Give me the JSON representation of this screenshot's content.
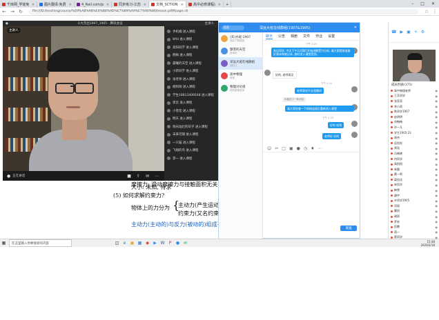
{
  "browser": {
    "tabs": [
      {
        "label": "千库网_学徒免费设计平台",
        "color": "#d93025",
        "active": false
      },
      {
        "label": "图片翻译:免费在线图片文字",
        "color": "#1a73e8",
        "active": false
      },
      {
        "label": "4_Rail.com/product.cgi",
        "color": "#7b1fa2",
        "active": false
      },
      {
        "label": "同步练习-江苏1号...",
        "color": "#d93025",
        "active": false
      },
      {
        "label": "文档_SCTION-知识点.pdf",
        "color": "#d93025",
        "active": true
      },
      {
        "label": "高中必修课程设计.pdf",
        "color": "#d93025",
        "active": false
      }
    ],
    "url": "file:///D:/teaching/course/%E9%AB%98%E4%B8%AD%E7%89%A9%E7%90%86/lesson.pdf#page=8"
  },
  "meeting": {
    "title": "十大杰出1907_1905 - 腾讯会议",
    "host_label": "主讲人",
    "speaker_badge": "主讲人",
    "mic_label": "正在讲话",
    "members": [
      "手机端 进入课程",
      "Wfd 进入课程",
      "高阳同学 进入课程",
      "韩梅 进入课程",
      "晨曦的天空 进入课程",
      "小新同学 进入课程",
      "张老师 进入课程",
      "杨阳阳 进入课程",
      "学生18813406648 进入课程",
      "李云 进入课程",
      "小雪花 进入课程",
      "明天 进入课程",
      "阳光灿烂的日子 进入课程",
      "未来可期 进入课程",
      "一只猫 进入课程",
      "飞翔的鸟 进入课程",
      "李一 进入课程"
    ]
  },
  "document": {
    "line1": "摩擦力: 滑动摩擦力与接触面积无关",
    "line2": "大小: 未知, 待求",
    "line3": "(5) 如何求解约束力?",
    "line4a": "物体上的力分为",
    "line4b": "主动力(产生运动)",
    "line4c": "约束力(又名约束反力)",
    "line5": "主动力(主动的)与反力(被动的)组成平衡力系——平衡条件"
  },
  "chat": {
    "title": "深远大班在线群组(1907&1905)",
    "search_placeholder": "搜索",
    "tabs": [
      "聊天",
      "公告",
      "相册",
      "文件",
      "作业",
      "设置"
    ],
    "contacts": [
      {
        "name": "(天)大班-1907",
        "sub": "发起了群语音",
        "color": "#f3a33b"
      },
      {
        "name": "飘雪的天空",
        "sub": "老师好",
        "color": "#4a90e2"
      },
      {
        "name": "深远大班在线群组",
        "sub": "[图片]",
        "color": "#7c5cc4"
      },
      {
        "name": "高中物理",
        "sub": "收到",
        "color": "#e24a4a"
      },
      {
        "name": "物理讨论组",
        "sub": "好的谢谢老师",
        "color": "#2fa86b"
      }
    ],
    "messages": [
      {
        "text": "各位同学, 今天下午2点我们开始讲解受力分析, 请大家提前准备好课本和笔记本, 按时进入课堂签到。",
        "side": "right"
      },
      {
        "text": "好的, 老师再见",
        "side": "left"
      },
      {
        "text": "老师我进不去直播间",
        "side": "right"
      },
      {
        "text": "请大家检查一下网络连接后重新进入课堂",
        "side": "right"
      },
      {
        "text": "好的 收到",
        "side": "right"
      },
      {
        "text": "老师好 好的",
        "side": "right"
      }
    ],
    "times": [
      "下午 2:20",
      "下午 2:24",
      "撤回了一条消息",
      "下午 2:25"
    ],
    "notice": "你撤回了一条消息",
    "send_label": "发送"
  },
  "participants": {
    "title": "成员列表(175)",
    "list": [
      "高中物理老师",
      "王芳同学",
      "张亮亮",
      "李小雨",
      "陈同学1907",
      "赵明明",
      "刘畅畅",
      "孙一凡",
      "学生1905-23",
      "周杰",
      "吴彤彤",
      "郑浩",
      "冯晓晓",
      "何同学",
      "高阳阳",
      "林晨",
      "黄一鸣",
      "梁佳佳",
      "宋同学",
      "韩雪",
      "唐宇",
      "许同学1905",
      "邓丽",
      "曹阳",
      "谢雨",
      "罗欢",
      "彭鹏",
      "蒋一",
      "蔡同学"
    ]
  },
  "taskbar": {
    "search_placeholder": "在这里输入你要搜索的内容",
    "time": "15:48",
    "date": "2020/2/18"
  }
}
